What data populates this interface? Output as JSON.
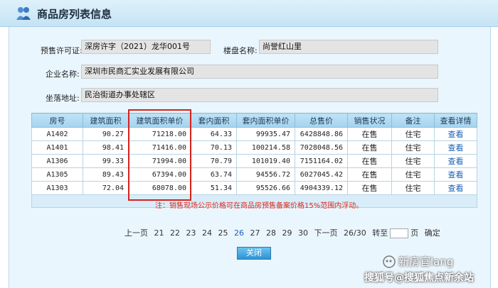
{
  "header": {
    "title": "商品房列表信息",
    "icon": "house-people-icon"
  },
  "info": {
    "permit_label": "预售许可证:",
    "permit_value": "深房许字（2021）龙华001号",
    "project_label": "楼盘名称:",
    "project_value": "尚誉红山里",
    "company_label": "企业名称:",
    "company_value": "深圳市民商汇实业发展有限公司",
    "address_label": "坐落地址:",
    "address_value": "民治街道办事处辖区"
  },
  "table": {
    "headers": [
      "房号",
      "建筑面积",
      "建筑面积单价",
      "套内面积",
      "套内面积单价",
      "总售价",
      "销售状况",
      "备注",
      "查看详情"
    ],
    "rows": [
      [
        "A1402",
        "90.27",
        "71218.00",
        "64.33",
        "99935.47",
        "6428848.86",
        "在售",
        "住宅",
        "查看"
      ],
      [
        "A1401",
        "98.41",
        "71416.00",
        "70.13",
        "100214.58",
        "7028048.56",
        "在售",
        "住宅",
        "查看"
      ],
      [
        "A1306",
        "99.33",
        "71994.00",
        "70.79",
        "101019.40",
        "7151164.02",
        "在售",
        "住宅",
        "查看"
      ],
      [
        "A1305",
        "89.43",
        "67394.00",
        "63.74",
        "94556.72",
        "6027045.42",
        "在售",
        "住宅",
        "查看"
      ],
      [
        "A1303",
        "72.04",
        "68078.00",
        "51.34",
        "95526.66",
        "4904339.12",
        "在售",
        "住宅",
        "查看"
      ]
    ]
  },
  "note": "注：销售现场公示价格可在商品房预售备案价格15%范围内浮动。",
  "pager": {
    "prev": "上一页",
    "pages": [
      "21",
      "22",
      "23",
      "24",
      "25",
      "26",
      "27",
      "28",
      "29",
      "30"
    ],
    "current": "26",
    "next": "下一页",
    "count": "26/30",
    "goto_label": "转至",
    "page_unit": "页",
    "confirm": "确定"
  },
  "close_label": "关闭",
  "watermark": {
    "line1": "新房官lang",
    "line2": "搜狐号@搜狐焦点新余站"
  },
  "colors": {
    "accent": "#2f93d3",
    "highlight": "#d6221c",
    "note": "#e02a1c"
  }
}
